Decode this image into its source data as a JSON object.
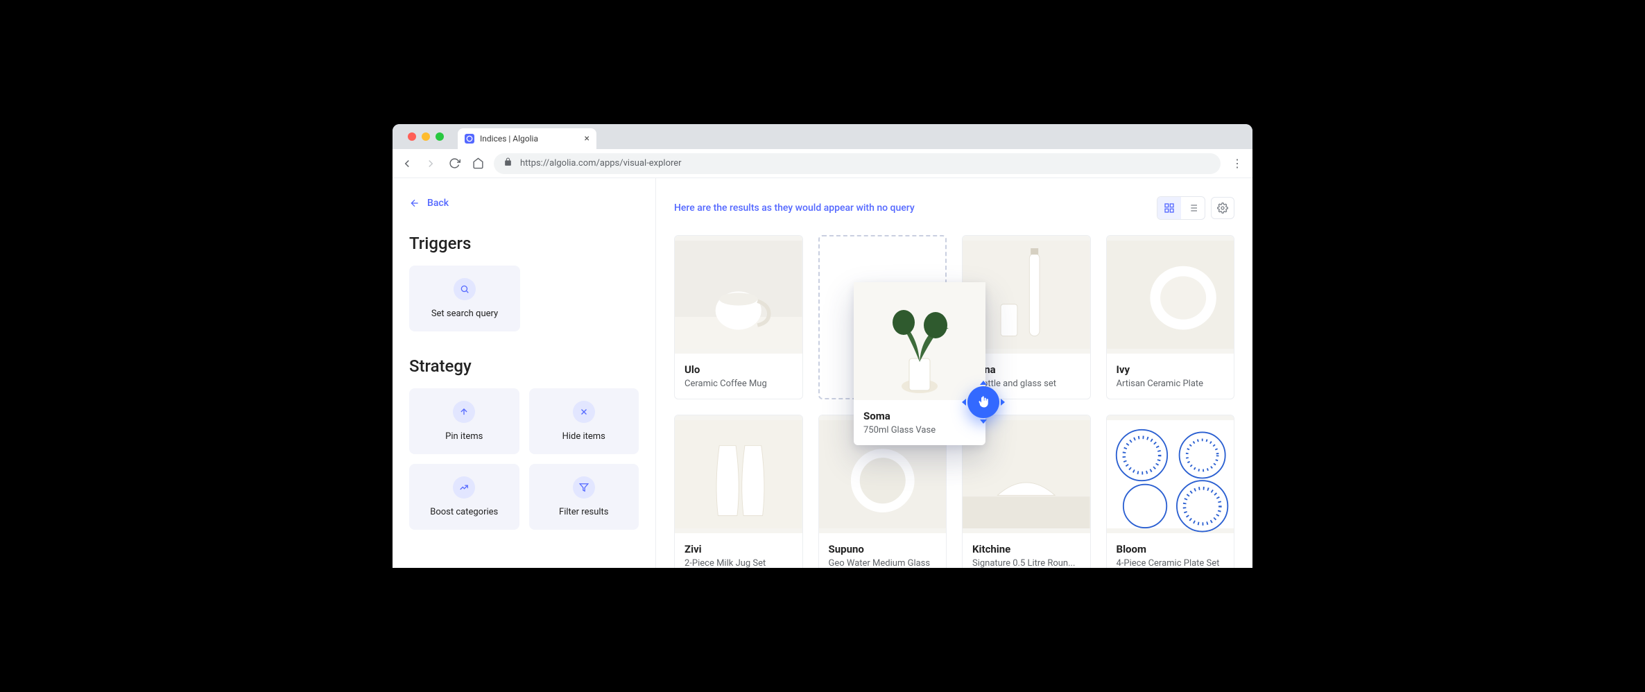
{
  "browser": {
    "tab_title": "Indices | Algolia",
    "url": "https://algolia.com/apps/visual-explorer"
  },
  "sidebar": {
    "back_label": "Back",
    "triggers_heading": "Triggers",
    "strategy_heading": "Strategy",
    "trigger_card": {
      "label": "Set search query",
      "icon": "search-icon"
    },
    "strategy_cards": [
      {
        "label": "Pin items",
        "icon": "arrow-up-icon"
      },
      {
        "label": "Hide items",
        "icon": "close-icon"
      },
      {
        "label": "Boost categories",
        "icon": "trend-up-icon"
      },
      {
        "label": "Filter results",
        "icon": "filter-icon"
      }
    ]
  },
  "main": {
    "hint_text": "Here are the results as they would appear with no query",
    "view_mode": "grid"
  },
  "dragged_card": {
    "title": "Soma",
    "subtitle": "750ml Glass Vase"
  },
  "products": [
    {
      "title": "Ulo",
      "subtitle": "Ceramic Coffee Mug"
    },
    {
      "title": "Yona",
      "subtitle": "Water bottle and glass set",
      "subtitle_visible": "r bottle and glass set"
    },
    {
      "title": "Ivy",
      "subtitle": "Artisan Ceramic Plate"
    },
    {
      "title": "Zivi",
      "subtitle": "2-Piece Milk Jug Set"
    },
    {
      "title": "Supuno",
      "subtitle": "Geo Water Medium Glass"
    },
    {
      "title": "Kitchine",
      "subtitle": "Signature 0.5 Litre Roun..."
    },
    {
      "title": "Bloom",
      "subtitle": "4-Piece Ceramic Plate Set"
    }
  ]
}
